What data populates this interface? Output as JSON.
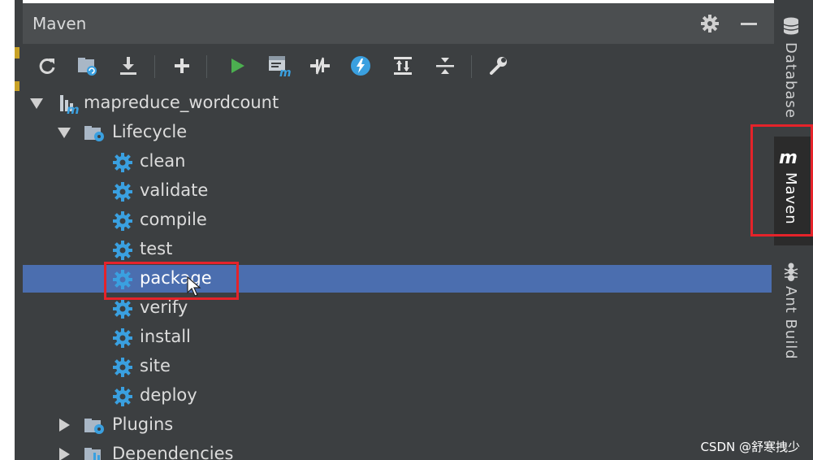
{
  "panel": {
    "title": "Maven"
  },
  "toolbar": {
    "buttons": [
      {
        "name": "reimport-all-icon"
      },
      {
        "name": "generate-sources-icon"
      },
      {
        "name": "download-sources-icon"
      },
      {
        "name": "add-maven-projects-icon"
      },
      {
        "name": "run-maven-build-icon"
      },
      {
        "name": "execute-maven-goal-icon"
      },
      {
        "name": "toggle-offline-mode-icon"
      },
      {
        "name": "skip-tests-icon"
      },
      {
        "name": "show-dependencies-icon"
      },
      {
        "name": "collapse-all-icon"
      },
      {
        "name": "maven-settings-icon"
      }
    ]
  },
  "tree": {
    "project": "mapreduce_wordcount",
    "lifecycle": {
      "label": "Lifecycle",
      "goals": [
        "clean",
        "validate",
        "compile",
        "test",
        "package",
        "verify",
        "install",
        "site",
        "deploy"
      ],
      "selected": "package"
    },
    "plugins": "Plugins",
    "dependencies": "Dependencies"
  },
  "rightbar": {
    "tabs": [
      {
        "label": "Database"
      },
      {
        "label": "Maven"
      },
      {
        "label": "Ant Build"
      }
    ],
    "maven_icon_text": "m"
  },
  "watermark": "CSDN @舒寒拽少",
  "colors": {
    "panel_bg": "#3c3f41",
    "selection": "#4b6eaf",
    "annotation_red": "#e5232a",
    "gear_blue": "#3aa0e0",
    "run_green": "#4caf50"
  }
}
